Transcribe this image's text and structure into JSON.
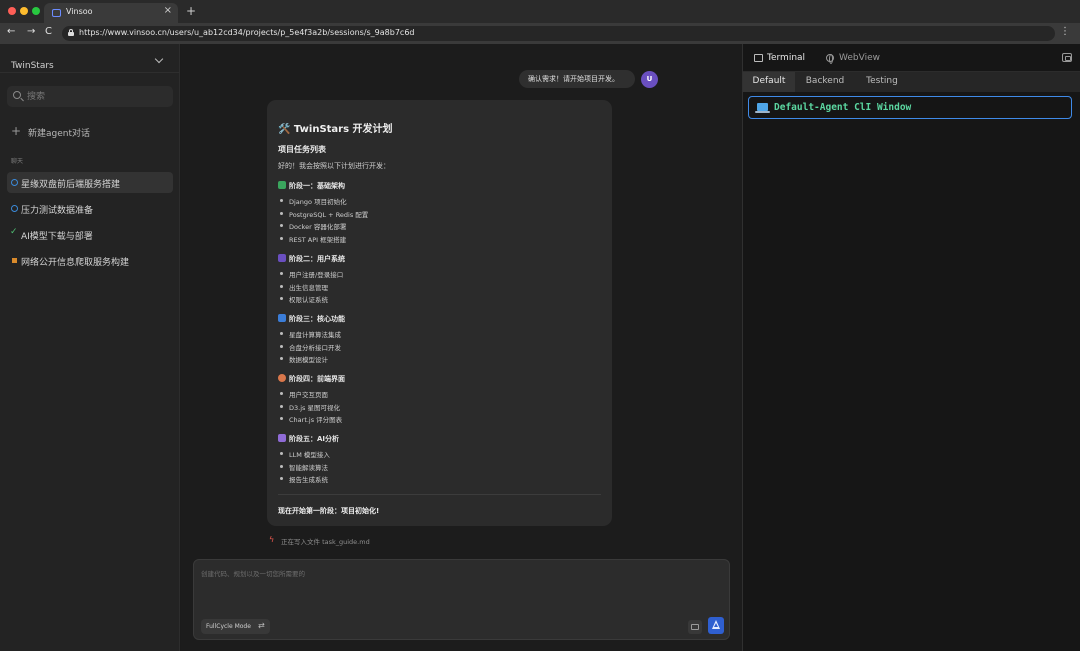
{
  "browser": {
    "tab_title": "Vinsoo",
    "tab_close": "×",
    "new_tab": "+",
    "nav_back": "←",
    "nav_forward": "→",
    "nav_reload": "C",
    "url": "https://www.vinsoo.cn/users/u_ab12cd34/projects/p_5e4f3a2b/sessions/s_9a8b7c6d",
    "menu": "⋮"
  },
  "sidebar": {
    "project_name": "TwinStars",
    "search_placeholder": "搜索",
    "new_chat_label": "新建agent对话",
    "section_label": "聊天",
    "sessions": [
      {
        "label": "星缘双盘前后端服务搭建",
        "status": "in-progress",
        "active": true
      },
      {
        "label": "压力测试数据准备",
        "status": "in-progress",
        "active": false
      },
      {
        "label": "AI模型下载与部署",
        "status": "done",
        "active": false
      },
      {
        "label": "网络公开信息爬取服务构建",
        "status": "stopped",
        "active": false
      }
    ]
  },
  "chat": {
    "user_message": "确认需求！请开始项目开发。",
    "user_avatar": "U",
    "plan": {
      "title": "🛠️ TwinStars 开发计划",
      "subtitle": "项目任务列表",
      "intro": "好的！我会按照以下计划进行开发：",
      "phases": [
        {
          "title": "阶段一：基础架构",
          "icon_color": "#3aa55d",
          "items": [
            "Django 项目初始化",
            "PostgreSQL + Redis 配置",
            "Docker 容器化部署",
            "REST API 框架搭建"
          ]
        },
        {
          "title": "阶段二：用户系统",
          "icon_color": "#6a4fc0",
          "items": [
            "用户注册/登录接口",
            "出生信息管理",
            "权限认证系统"
          ]
        },
        {
          "title": "阶段三：核心功能",
          "icon_color": "#3b7dd8",
          "items": [
            "星盘计算算法集成",
            "合盘分析接口开发",
            "数据模型设计"
          ]
        },
        {
          "title": "阶段四：前端界面",
          "icon_color": "#d9774b",
          "items": [
            "用户交互页面",
            "D3.js 星图可视化",
            "Chart.js 评分图表"
          ]
        },
        {
          "title": "阶段五：AI分析",
          "icon_color": "#8f6bd6",
          "items": [
            "LLM 模型接入",
            "智能解读算法",
            "报告生成系统"
          ]
        }
      ],
      "footer": "现在开始第一阶段：项目初始化!"
    },
    "status_icon": "ϟ",
    "status_text": "正在写入文件 task_guide.md",
    "composer": {
      "placeholder": "创建代码、规划以及一切您所需要的",
      "mode_label": "FullCycle Mode",
      "mode_icon": "⇄"
    }
  },
  "right_panel": {
    "tabs": [
      "Terminal",
      "WebView"
    ],
    "active_tab": "Terminal",
    "subtabs": [
      "Default",
      "Backend",
      "Testing"
    ],
    "active_subtab": "Default",
    "terminal_window_title": "Default-Agent ClI Window"
  },
  "colors": {
    "accent": "#3f8ae8",
    "send_button": "#2f5fd0",
    "terminal_title": "#5bd6a0",
    "avatar": "#6a4fc0"
  }
}
